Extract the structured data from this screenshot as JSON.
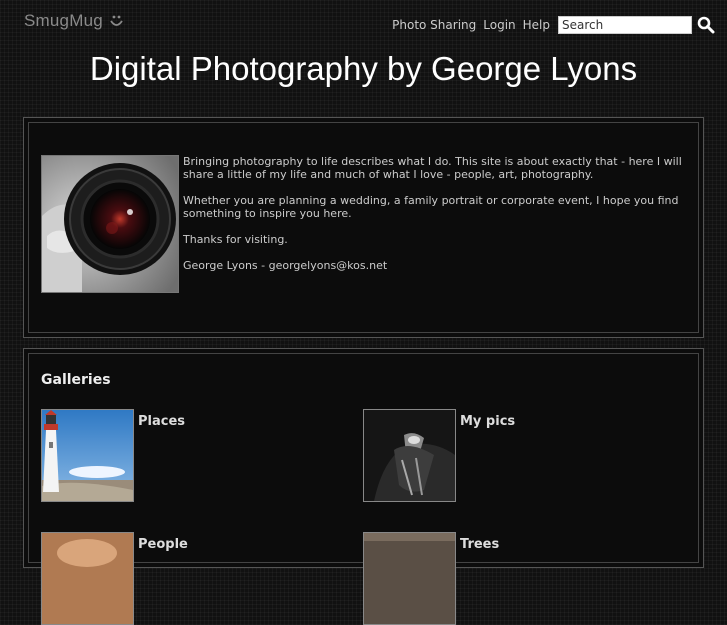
{
  "brand": {
    "logo_text": "SmugMug",
    "logo_icon": "smiley-icon"
  },
  "topnav": {
    "links": [
      "Photo Sharing",
      "Login",
      "Help"
    ],
    "search_placeholder": "Search",
    "search_icon": "search-icon"
  },
  "page": {
    "title": "Digital Photography by George Lyons"
  },
  "bio": {
    "image": "camera-lens-portrait",
    "paragraphs": [
      "Bringing photography to life describes what I do. This site is about exactly that - here I will share a little of my life and much of what I love - people, art, photography.",
      "Whether you are planning a wedding, a family portrait or corporate event, I hope you find something to inspire you here.",
      "Thanks for visiting.",
      "George Lyons - georgelyons@kos.net"
    ]
  },
  "galleries": {
    "heading": "Galleries",
    "items": [
      {
        "name": "Places",
        "thumb": "lighthouse"
      },
      {
        "name": "My pics",
        "thumb": "car-hood-ornament"
      },
      {
        "name": "People",
        "thumb": "people"
      },
      {
        "name": "Trees",
        "thumb": "trees"
      }
    ]
  },
  "colors": {
    "background": "#111111",
    "panel_border": "#555555",
    "text": "#cccccc",
    "title": "#ffffff"
  }
}
